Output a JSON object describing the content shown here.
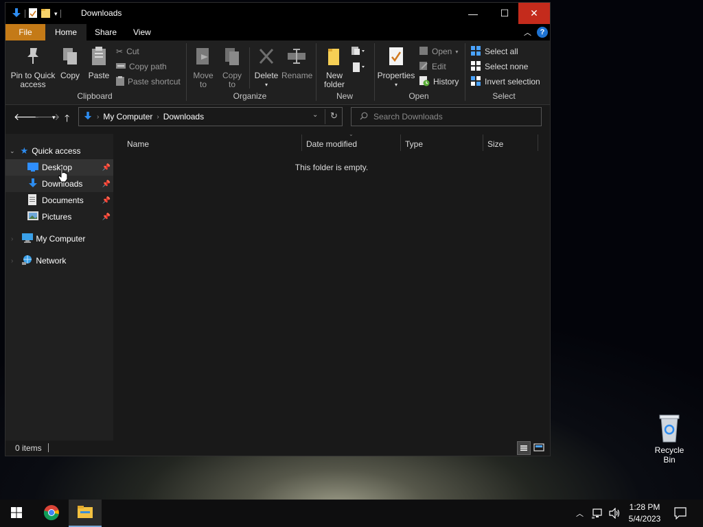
{
  "window": {
    "title": "Downloads",
    "controls": {
      "minimize": "—",
      "maximize": "☐",
      "close": "✕"
    }
  },
  "ribbon": {
    "tabs": {
      "file": "File",
      "home": "Home",
      "share": "Share",
      "view": "View"
    },
    "clipboard": {
      "pin": [
        "Pin to Quick",
        "access"
      ],
      "copy": "Copy",
      "paste": "Paste",
      "cut": "Cut",
      "copy_path": "Copy path",
      "paste_shortcut": "Paste shortcut",
      "label": "Clipboard"
    },
    "organize": {
      "move_to": [
        "Move",
        "to"
      ],
      "copy_to": [
        "Copy",
        "to"
      ],
      "delete": "Delete",
      "rename": "Rename",
      "label": "Organize"
    },
    "new": {
      "new_folder": [
        "New",
        "folder"
      ],
      "label": "New"
    },
    "open": {
      "properties": "Properties",
      "open": "Open",
      "edit": "Edit",
      "history": "History",
      "label": "Open"
    },
    "select": {
      "select_all": "Select all",
      "select_none": "Select none",
      "invert": "Invert selection",
      "label": "Select"
    }
  },
  "address": {
    "crumbs": [
      "My Computer",
      "Downloads"
    ],
    "search_placeholder": "Search Downloads"
  },
  "nav": {
    "quick_access": "Quick access",
    "pinned": [
      "Desktop",
      "Downloads",
      "Documents",
      "Pictures"
    ],
    "my_computer": "My Computer",
    "network": "Network"
  },
  "content": {
    "columns": [
      "Name",
      "Date modified",
      "Type",
      "Size"
    ],
    "empty_text": "This folder is empty."
  },
  "status": {
    "items": "0 items"
  },
  "desktop": {
    "recycle_bin": "Recycle Bin"
  },
  "taskbar": {
    "time": "1:28 PM",
    "date": "5/4/2023"
  },
  "colors": {
    "accent_file_tab": "#c47a17",
    "close_button": "#c42b1c",
    "icon_blue": "#2d8cf0"
  }
}
